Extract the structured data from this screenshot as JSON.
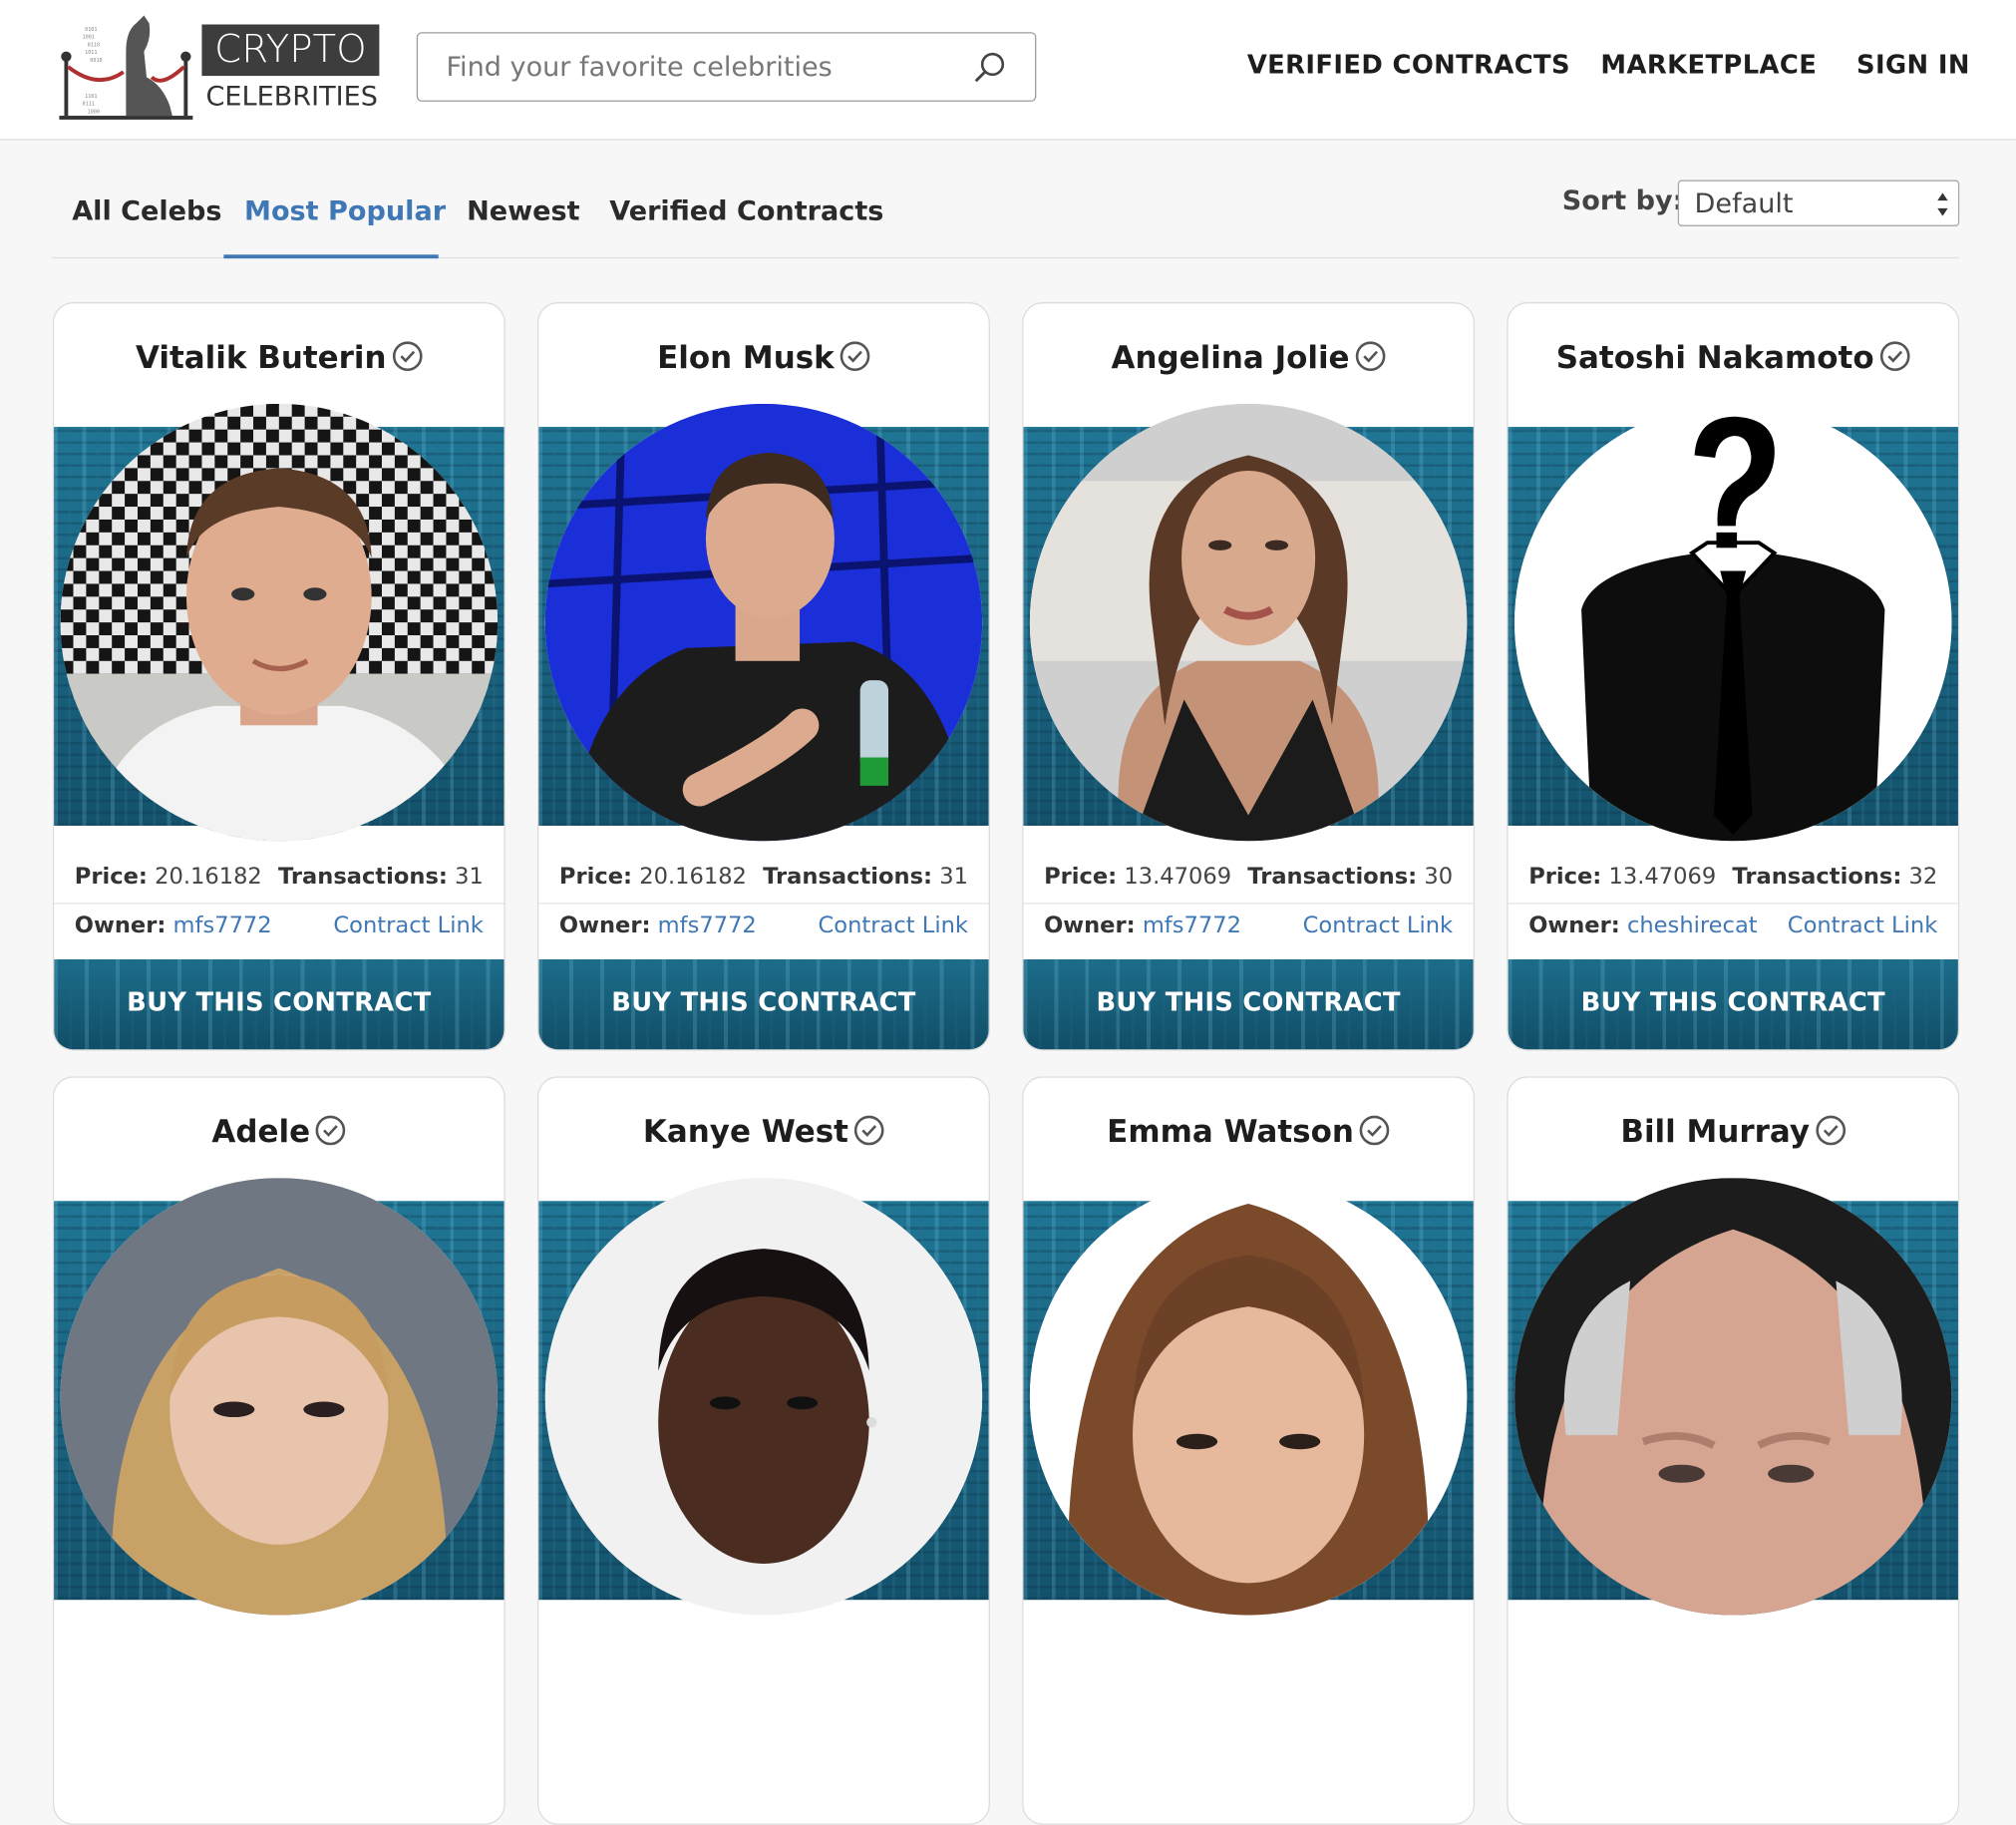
{
  "header": {
    "logo_top": "CRYPTO",
    "logo_bottom": "CELEBRITIES",
    "search_placeholder": "Find your favorite celebrities",
    "nav": [
      "VERIFIED CONTRACTS",
      "MARKETPLACE",
      "SIGN IN"
    ]
  },
  "tabs": {
    "items": [
      "All Celebs",
      "Most Popular",
      "Newest",
      "Verified Contracts"
    ],
    "active": "Most Popular"
  },
  "sort": {
    "label": "Sort by:",
    "value": "Default"
  },
  "labels": {
    "price": "Price:",
    "transactions": "Transactions:",
    "owner": "Owner:",
    "contract_link": "Contract Link",
    "buy": "BUY THIS CONTRACT"
  },
  "cards": [
    {
      "name": "Vitalik Buterin",
      "price": "20.16182",
      "transactions": "31",
      "owner": "mfs7772"
    },
    {
      "name": "Elon Musk",
      "price": "20.16182",
      "transactions": "31",
      "owner": "mfs7772"
    },
    {
      "name": "Angelina Jolie",
      "price": "13.47069",
      "transactions": "30",
      "owner": "mfs7772"
    },
    {
      "name": "Satoshi Nakamoto",
      "price": "13.47069",
      "transactions": "32",
      "owner": "cheshirecat"
    },
    {
      "name": "Adele"
    },
    {
      "name": "Kanye West"
    },
    {
      "name": "Emma Watson"
    },
    {
      "name": "Bill Murray"
    }
  ],
  "colors": {
    "accent": "#4078b6",
    "banner": "#1a6883",
    "text": "#1d1d1d"
  }
}
